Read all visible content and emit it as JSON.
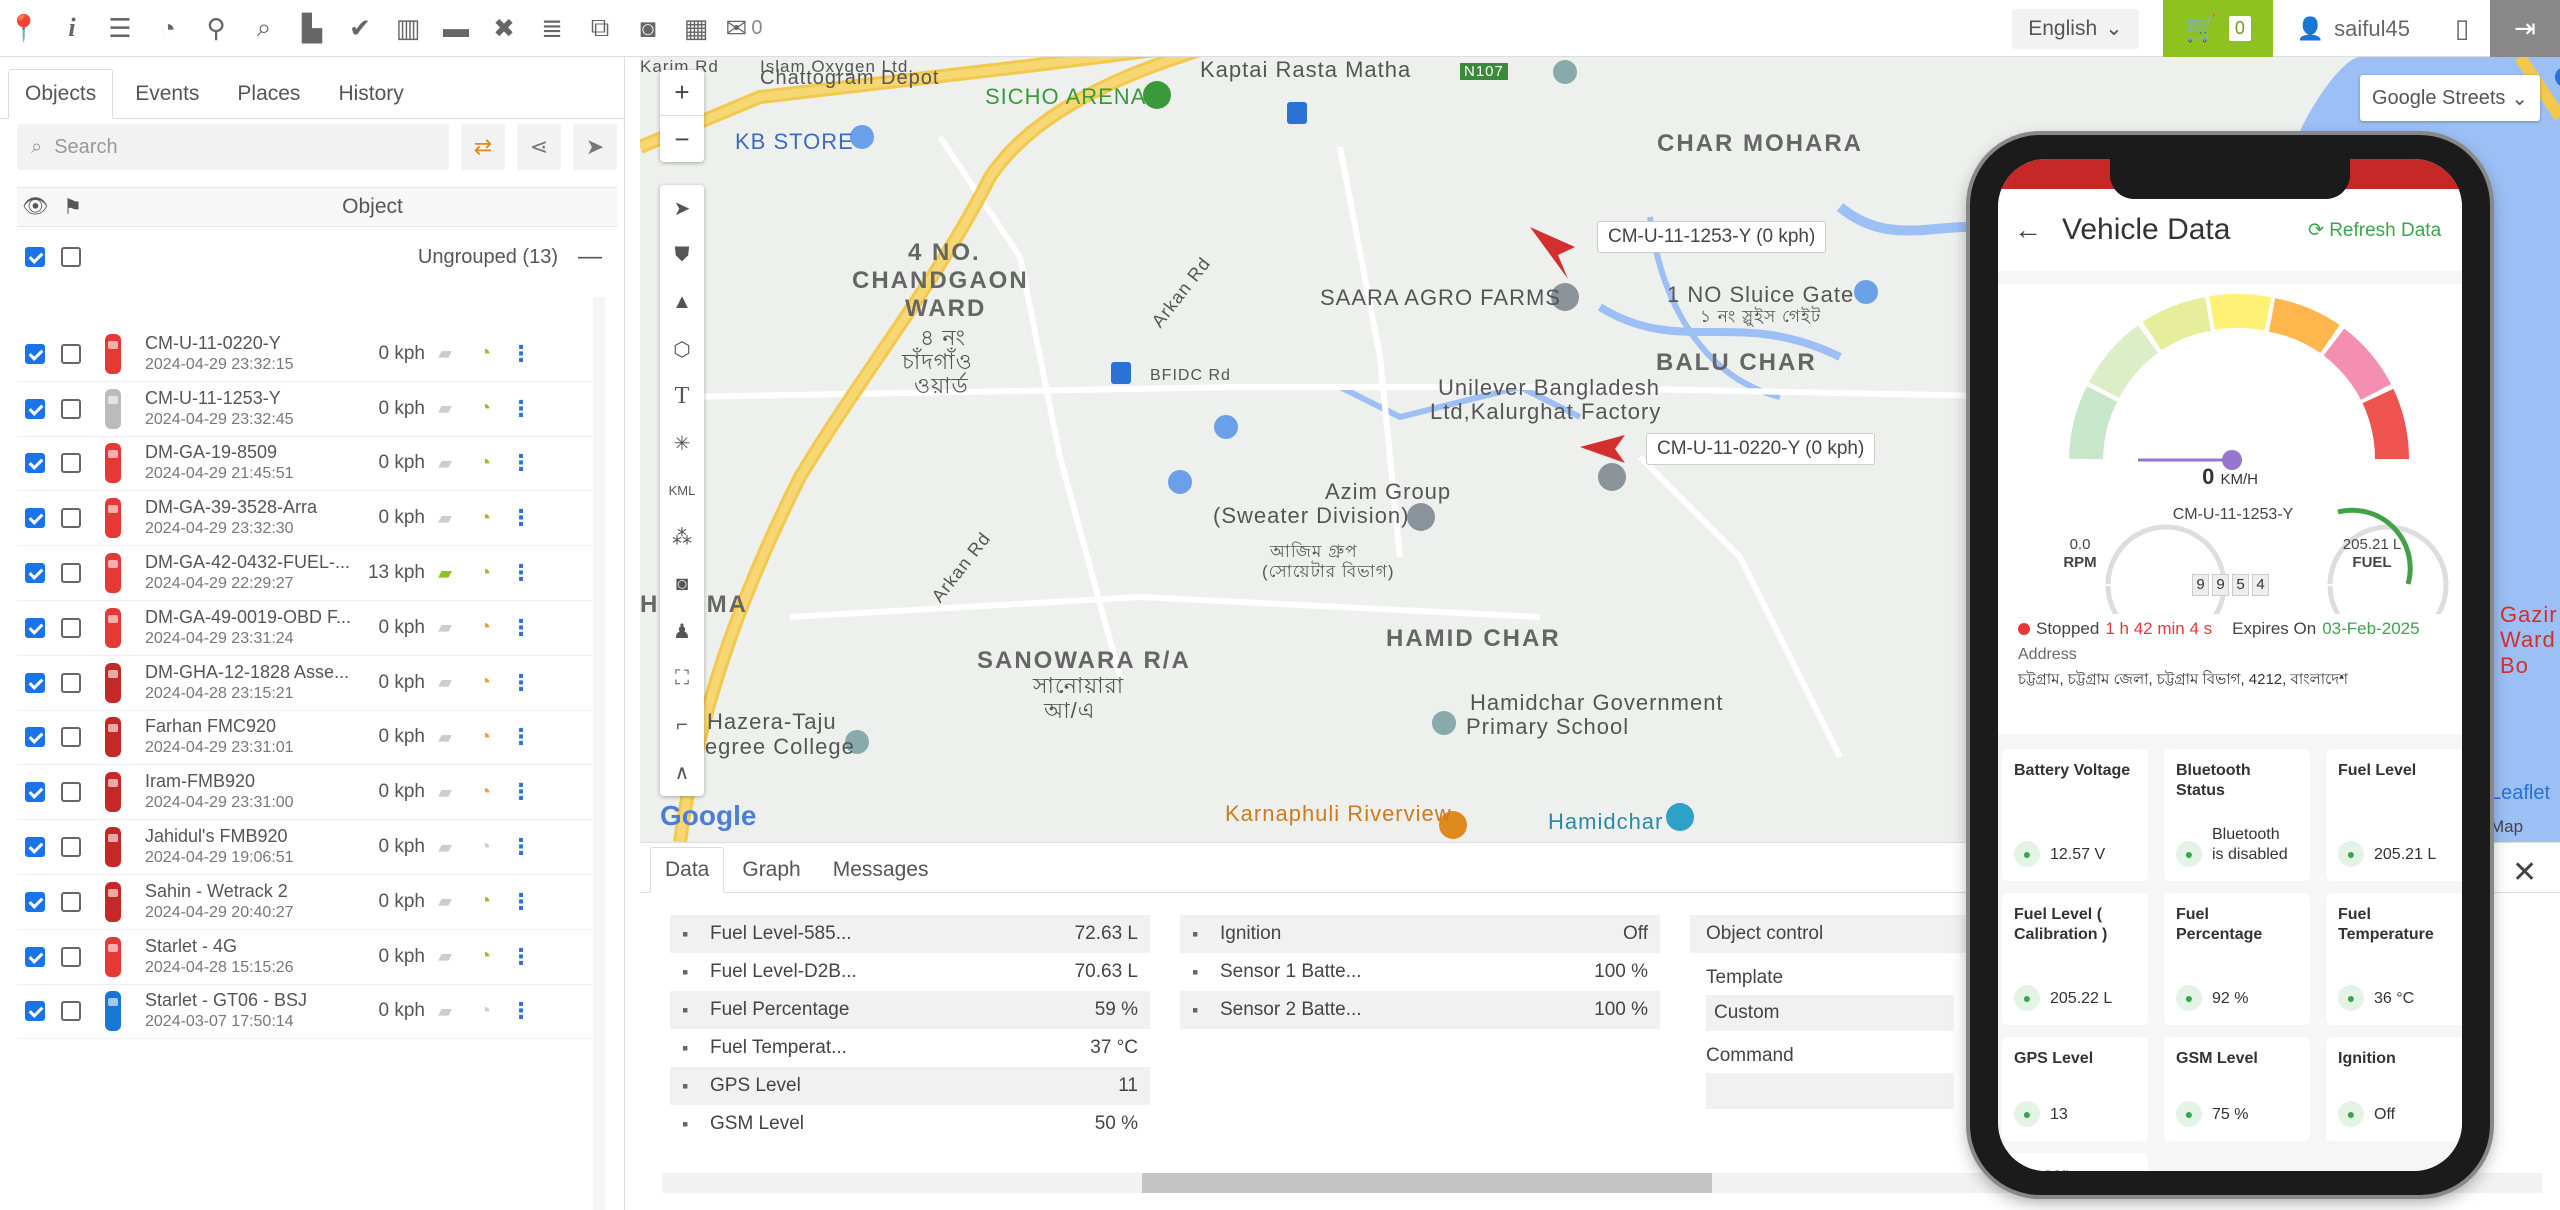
{
  "topbar": {
    "icons": [
      "map-pin-icon",
      "info-icon",
      "sliders-icon",
      "dashboard-icon",
      "location-icon",
      "search-icon",
      "chart-icon",
      "check-icon",
      "book-icon",
      "car-icon",
      "tools-icon",
      "database-icon",
      "code-icon",
      "camera-icon",
      "film-icon",
      "chat-icon"
    ],
    "chat_count": "0",
    "language": "English",
    "cart_count": "0",
    "username": "saiful45"
  },
  "left": {
    "tabs": [
      "Objects",
      "Events",
      "Places",
      "History"
    ],
    "search_placeholder": "Search",
    "col_object": "Object",
    "group_label": "Ungrouped (13)",
    "rows": [
      {
        "name": "CM-U-11-0220-Y",
        "date": "2024-04-29 23:32:15",
        "speed": "0 kph"
      },
      {
        "name": "CM-U-11-1253-Y",
        "date": "2024-04-29 23:32:45",
        "speed": "0 kph"
      },
      {
        "name": "DM-GA-19-8509",
        "date": "2024-04-29 21:45:51",
        "speed": "0 kph"
      },
      {
        "name": "DM-GA-39-3528-Arra",
        "date": "2024-04-29 23:32:30",
        "speed": "0 kph"
      },
      {
        "name": "DM-GA-42-0432-FUEL-...",
        "date": "2024-04-29 22:29:27",
        "speed": "13 kph"
      },
      {
        "name": "DM-GA-49-0019-OBD F...",
        "date": "2024-04-29 23:31:24",
        "speed": "0 kph"
      },
      {
        "name": "DM-GHA-12-1828 Asse...",
        "date": "2024-04-28 23:15:21",
        "speed": "0 kph"
      },
      {
        "name": "Farhan FMC920",
        "date": "2024-04-29 23:31:01",
        "speed": "0 kph"
      },
      {
        "name": "Iram-FMB920",
        "date": "2024-04-29 23:31:00",
        "speed": "0 kph"
      },
      {
        "name": "Jahidul's FMB920",
        "date": "2024-04-29 19:06:51",
        "speed": "0 kph"
      },
      {
        "name": "Sahin - Wetrack 2",
        "date": "2024-04-29 20:40:27",
        "speed": "0 kph"
      },
      {
        "name": "Starlet - 4G",
        "date": "2024-04-28 15:15:26",
        "speed": "0 kph"
      },
      {
        "name": "Starlet - GT06 - BSJ",
        "date": "2024-03-07 17:50:14",
        "speed": "0 kph"
      }
    ]
  },
  "map": {
    "layer": "Google Streets",
    "labels": {
      "karim": "Karim Rd",
      "islam": "Islam Oxygen Ltd.",
      "chattogram": "Chattogram Depot",
      "kaptai": "Kaptai Rasta Matha",
      "n107": "N107",
      "sicho": "SICHO ARENA",
      "kb": "KB STORE",
      "charmohara": "CHAR MOHARA",
      "chandgaon1": "4 NO.",
      "chandgaon2": "CHANDGAON",
      "chandgaon3": "WARD",
      "bn1": "৪ নং",
      "bn2": "চাঁদগাঁও",
      "bn3": "ওয়ার্ড",
      "saara": "SAARA AGRO FARMS",
      "sluice": "1 NO Sluice Gate",
      "sluicebn": "১ নং স্লুইস গেইট",
      "baluchar": "BALU CHAR",
      "bfidc": "BFIDC Rd",
      "arkan": "Arkan Rd",
      "arkan2": "Arkan Rd",
      "unilever1": "Unilever Bangladesh",
      "unilever2": "Ltd,Kalurghat Factory",
      "azim1": "Azim Group",
      "azim2": "(Sweater Division)",
      "azimbn1": "আজিম গ্রুপ",
      "azimbn2": "(সোয়েটার বিভাগ)",
      "harima": "HARIMA",
      "sanowara": "SANOWARA R/A",
      "sanowarabn1": "সানোয়ারা",
      "sanowarabn2": "আ/এ",
      "hamidchar": "HAMID CHAR",
      "hamidgov1": "Hamidchar Government",
      "hamidgov2": "Primary School",
      "hazera1": "Hazera-Taju",
      "hazera2": "Degree College",
      "karnaphuli": "Karnaphuli Riverview",
      "hamidchar2": "Hamidchar",
      "gazir1": "Gazir",
      "gazir2": "Ward Bo",
      "tip1": "CM-U-11-1253-Y (0 kph)",
      "tip2": "CM-U-11-0220-Y (0 kph)",
      "google": "Google",
      "leaflet": "Leaflet",
      "maperr": "Map error"
    }
  },
  "bottom": {
    "tabs": [
      "Data",
      "Graph",
      "Messages"
    ],
    "col1": [
      {
        "label": "Fuel Level-585...",
        "value": "72.63 L"
      },
      {
        "label": "Fuel Level-D2B...",
        "value": "70.63 L"
      },
      {
        "label": "Fuel Percentage",
        "value": "59 %"
      },
      {
        "label": "Fuel Temperat...",
        "value": "37 °C"
      },
      {
        "label": "GPS Level",
        "value": "11"
      },
      {
        "label": "GSM Level",
        "value": "50 %"
      }
    ],
    "col2": [
      {
        "label": "Ignition",
        "value": "Off"
      },
      {
        "label": "Sensor 1 Batte...",
        "value": "100 %"
      },
      {
        "label": "Sensor 2 Batte...",
        "value": "100 %"
      }
    ],
    "objctl": {
      "title": "Object control",
      "template_label": "Template",
      "template_value": "Custom",
      "command_label": "Command"
    }
  },
  "phone": {
    "title": "Vehicle Data",
    "refresh": "Refresh Data",
    "speed": "0",
    "unit": "KM/H",
    "plate": "CM-U-11-1253-Y",
    "rpm_value": "0.0",
    "rpm_label": "RPM",
    "fuel_value": "205.21 L",
    "fuel_label": "FUEL",
    "odometer": [
      "9",
      "9",
      "5",
      "4"
    ],
    "status": "Stopped",
    "duration": "1 h 42 min 4 s",
    "expires_label": "Expires On",
    "expires": "03-Feb-2025",
    "address_label": "Address",
    "address": "চট্টগ্রাম, চট্টগ্রাম জেলা, চট্টগ্রাম বিভাগ, 4212, বাংলাদেশ",
    "tiles": [
      {
        "label": "Battery Voltage",
        "value": "12.57 V"
      },
      {
        "label": "Bluetooth Status",
        "value": "Bluetooth is disabled"
      },
      {
        "label": "Fuel Level",
        "value": "205.21 L"
      },
      {
        "label": "Fuel Level ( Calibration )",
        "value": "205.22 L"
      },
      {
        "label": "Fuel Percentage",
        "value": "92 %"
      },
      {
        "label": "Fuel Temperature",
        "value": "36 °C"
      },
      {
        "label": "GPS Level",
        "value": "13"
      },
      {
        "label": "GSM Level",
        "value": "75 %"
      },
      {
        "label": "Ignition",
        "value": "Off"
      },
      {
        "label": "Sensor",
        "value": ""
      }
    ]
  }
}
